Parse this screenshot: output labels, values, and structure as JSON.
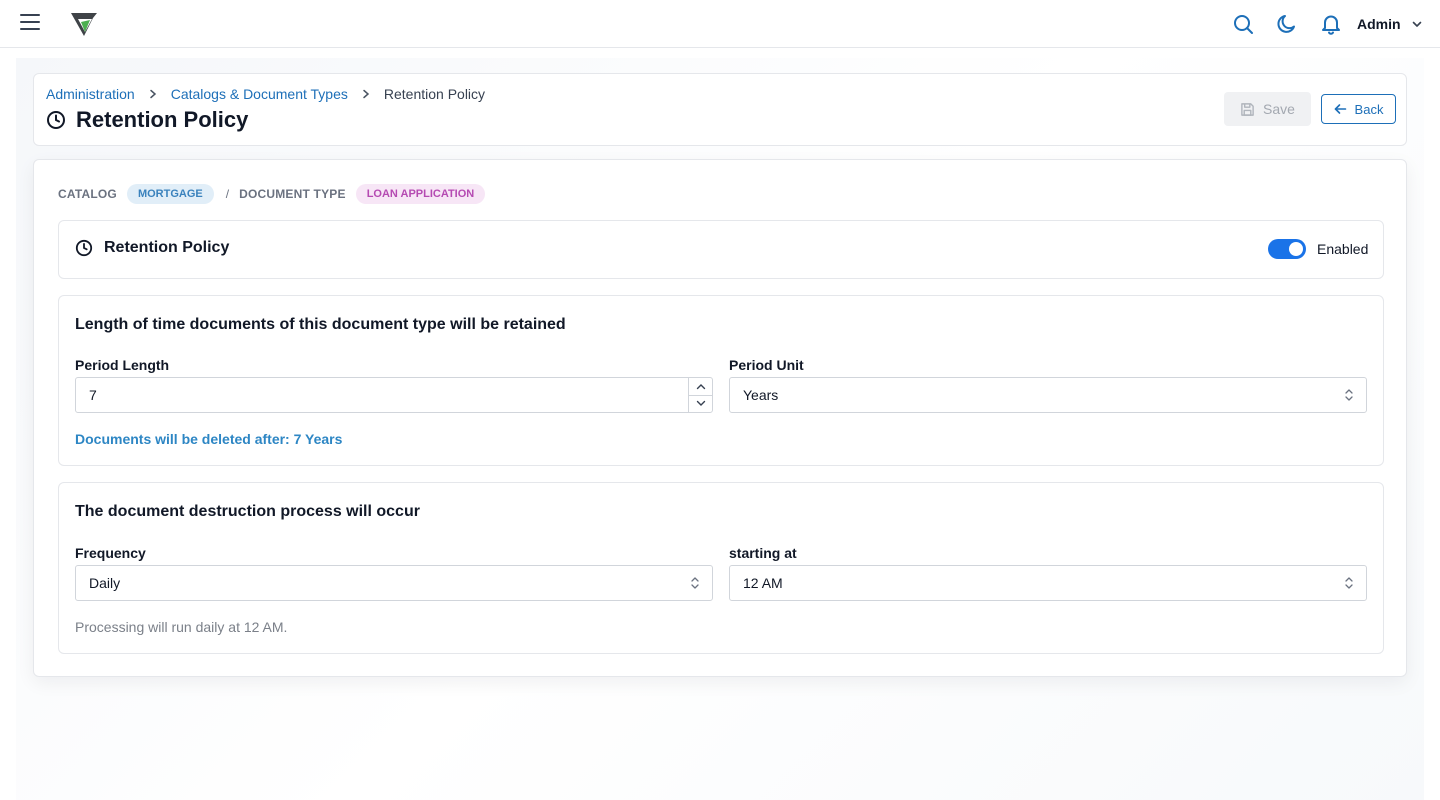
{
  "topbar": {
    "user_name": "Admin",
    "icons": [
      "menu-icon",
      "search-icon",
      "moon-icon",
      "bell-icon",
      "chevron-down-icon"
    ]
  },
  "breadcrumb": {
    "items": [
      "Administration",
      "Catalogs & Document Types"
    ],
    "current": "Retention Policy"
  },
  "page": {
    "title": "Retention Policy",
    "save_label": "Save",
    "back_label": "Back"
  },
  "meta": {
    "catalog_label": "CATALOG",
    "catalog_value": "MORTGAGE",
    "separator": "/",
    "doctype_label": "DOCUMENT TYPE",
    "doctype_value": "LOAN APPLICATION"
  },
  "policy": {
    "title": "Retention Policy",
    "enabled": true,
    "status_label": "Enabled"
  },
  "length_section": {
    "heading": "Length of time documents of this document type will be retained",
    "period_length_label": "Period Length",
    "period_length_value": "7",
    "period_unit_label": "Period Unit",
    "period_unit_value": "Years",
    "summary": "Documents will be deleted after: 7 Years"
  },
  "destruction_section": {
    "heading": "The document destruction process will occur",
    "frequency_label": "Frequency",
    "frequency_value": "Daily",
    "starting_at_label": "starting at",
    "starting_at_value": "12 AM",
    "summary": "Processing will run daily at 12 AM."
  },
  "colors": {
    "accent": "#1d6fb8",
    "toggle_on": "#1a73e8",
    "badge_mortgage_bg": "#e1eef8",
    "badge_mortgage_text": "#3a82bd",
    "badge_loan_bg": "#f7e6f6",
    "badge_loan_text": "#b54ab2",
    "logo_green": "#4caf50"
  }
}
